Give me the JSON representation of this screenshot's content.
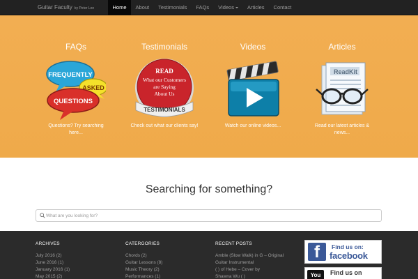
{
  "nav": {
    "brand": "Guitar Faculty",
    "brand_by": "by Peter Lee",
    "items": [
      {
        "label": "Home",
        "active": true
      },
      {
        "label": "About"
      },
      {
        "label": "Testimonials"
      },
      {
        "label": "FAQs"
      },
      {
        "label": "Videos"
      },
      {
        "label": "Articles"
      },
      {
        "label": "Contact"
      }
    ]
  },
  "colors": {
    "navbar": "#222222",
    "hero": "#f0ad4e",
    "footer": "#2b2b2b",
    "facebook": "#3b5998"
  },
  "features": [
    {
      "title": "FAQs",
      "icon": "faq-speech-bubbles-icon",
      "bubble_texts": [
        "FREQUENTLY",
        "ASKED",
        "QUESTIONS"
      ],
      "desc_line1": "Questions? Try searching",
      "desc_line2": "here..."
    },
    {
      "title": "Testimonials",
      "icon": "testimonials-seal-icon",
      "seal_texts": [
        "READ",
        "What our Customers",
        "are Saying",
        "About Us",
        "TESTIMONIALS"
      ],
      "desc_line1": "Check out what our clients say!",
      "desc_line2": ""
    },
    {
      "title": "Videos",
      "icon": "clapperboard-play-icon",
      "desc_line1": "Watch our online videos...",
      "desc_line2": ""
    },
    {
      "title": "Articles",
      "icon": "newspaper-glasses-icon",
      "paper_text": "ReadKit",
      "desc_line1": "Read our latest articles &",
      "desc_line2": "news..."
    }
  ],
  "search": {
    "heading": "Searching for something?",
    "placeholder": "What are you looking for?"
  },
  "footer": {
    "archives": {
      "heading": "ARCHIVES",
      "items": [
        "July 2016 (2)",
        "June 2016 (1)",
        "January 2016 (1)",
        "May 2015 (2)"
      ]
    },
    "categories": {
      "heading": "CATERGORIES",
      "items": [
        "Chords (2)",
        "Guitar Lessons (8)",
        "Music Theory (2)",
        "Performances (1)"
      ]
    },
    "recent": {
      "heading": "RECENT POSTS",
      "items": [
        "Amble (Slow Walk) in G – Original",
        "Guitar Instrumental",
        "( ) of Hebe  – Cover by",
        "Shawna Wu ( )"
      ]
    },
    "facebook": {
      "find": "Find us on:",
      "name": "facebook",
      "mark": "f"
    },
    "youtube": {
      "find": "Find us on",
      "mark": "You"
    }
  }
}
